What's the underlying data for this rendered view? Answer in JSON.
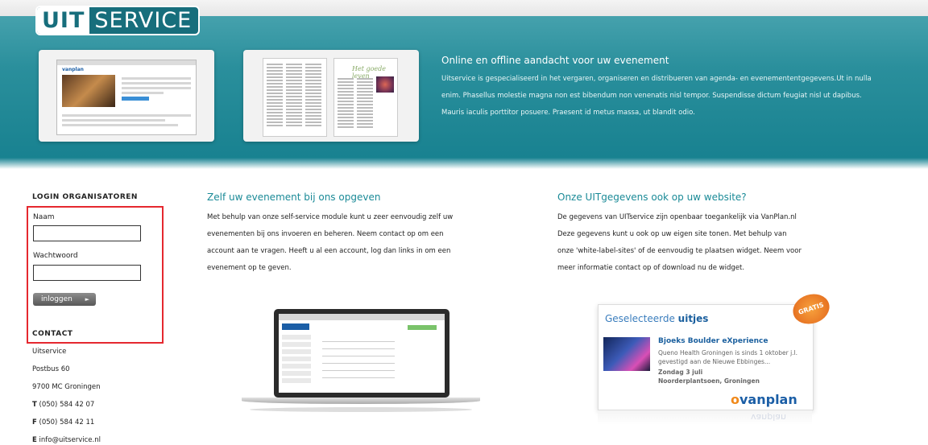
{
  "header": {
    "logo_uit": "UIT",
    "logo_service": "SERVICE",
    "hero_title": "Online en offline aandacht voor uw evenement",
    "hero_body": "Uitservice is gespecialiseerd in het vergaren, organiseren en distribueren van agenda- en evenemententgegevens.Ut in nulla enim. Phasellus molestie magna non est bibendum non venenatis nisl tempor. Suspendisse dictum feugiat nisl ut dapibus. Mauris iaculis porttitor posuere. Praesent id metus massa, ut blandit odio."
  },
  "thumbnails": {
    "browser_brand": "vanplan",
    "paper_title": "Het goede leven"
  },
  "login": {
    "heading": "LOGIN ORGANISATOREN",
    "name_label": "Naam",
    "password_label": "Wachtwoord",
    "button_label": "inloggen",
    "button_arrow": "►"
  },
  "contact": {
    "heading": "CONTACT",
    "company": "Uitservice",
    "postbus": "Postbus 60",
    "city": "9700 MC Groningen",
    "phone_prefix": "T",
    "phone": "(050) 584 42 07",
    "fax_prefix": "F",
    "fax": "(050) 584 42 11",
    "email_prefix": "E",
    "email": "info@uitservice.nl"
  },
  "self_service": {
    "title": "Zelf uw evenement bij ons opgeven",
    "line1": "Met behulp van onze self-service module kunt u zeer eenvoudig zelf uw",
    "line2": "evenementen bij ons invoeren en beheren. Neem contact op om een",
    "line3": "account aan te vragen. Heeft u al een account, log dan links in om een",
    "line4": "evenement op te geven."
  },
  "widget_section": {
    "title": "Onze UITgegevens ook op uw website?",
    "line1": "De gegevens van UITservice zijn openbaar toegankelijk via VanPlan.nl",
    "line2": "Deze gegevens kunt u ook op uw eigen site tonen. Met behulp van",
    "line3": "onze 'white-label-sites' of de eenvoudig te plaatsen widget. Neem voor",
    "line4": "meer informatie contact op of download nu de widget."
  },
  "widget": {
    "head_prefix": "Geselecteerde",
    "head_bold": "uitjes",
    "badge": "GRATIS",
    "event": "Bjoeks Boulder eXperience",
    "desc": "Queno Health Groningen is sinds 1 oktober j.l. gevestigd aan de Nieuwe Ebbinges...",
    "date": "Zondag 3 juli",
    "location": "Noorderplantsoen, Groningen",
    "brand_o": "o",
    "brand": "vanplan"
  },
  "colors": {
    "accent": "#1a8a97",
    "hero": "#16808f",
    "highlight_border": "#e5282f"
  }
}
